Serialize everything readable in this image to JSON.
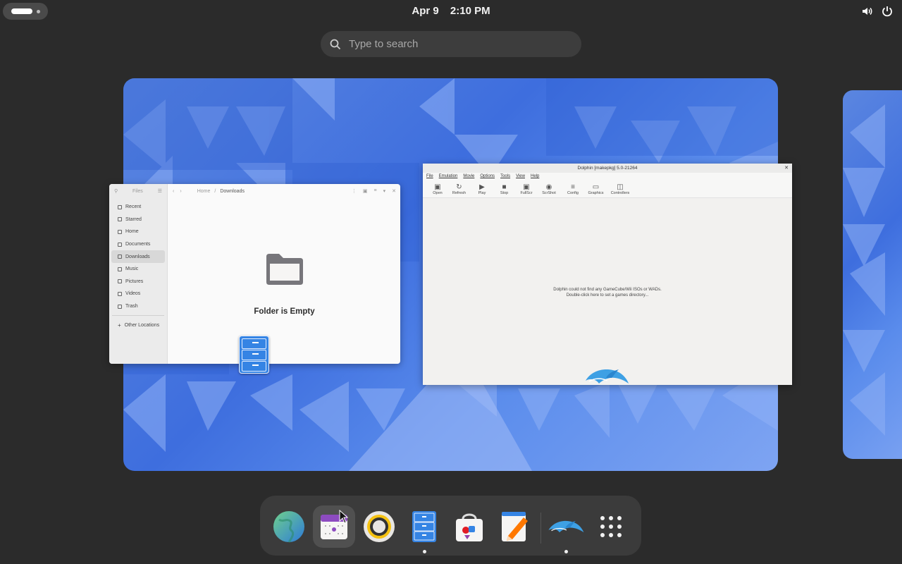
{
  "topbar": {
    "date": "Apr 9",
    "time": "2:10 PM",
    "tray": [
      "volume-icon",
      "power-icon"
    ]
  },
  "search": {
    "placeholder": "Type to search"
  },
  "files_window": {
    "sidebar_title": "Files",
    "sidebar_items": [
      {
        "label": "Recent",
        "icon": "clock-icon"
      },
      {
        "label": "Starred",
        "icon": "star-icon"
      },
      {
        "label": "Home",
        "icon": "home-icon"
      },
      {
        "label": "Documents",
        "icon": "document-icon"
      },
      {
        "label": "Downloads",
        "icon": "download-icon",
        "active": true
      },
      {
        "label": "Music",
        "icon": "music-icon"
      },
      {
        "label": "Pictures",
        "icon": "picture-icon"
      },
      {
        "label": "Videos",
        "icon": "video-icon"
      },
      {
        "label": "Trash",
        "icon": "trash-icon"
      }
    ],
    "other_locations": "Other Locations",
    "path": [
      "Home",
      "Downloads"
    ],
    "empty_message": "Folder is Empty"
  },
  "dolphin_window": {
    "title": "Dolphin [makepkg] 5.0-21264",
    "menu": [
      "File",
      "Emulation",
      "Movie",
      "Options",
      "Tools",
      "View",
      "Help"
    ],
    "toolbar": [
      "Open",
      "Refresh",
      "Play",
      "Stop",
      "FullScr",
      "ScrShot",
      "Config",
      "Graphics",
      "Controllers"
    ],
    "message_line1": "Dolphin could not find any GameCube/Wii ISOs or WADs.",
    "message_line2": "Double-click here to set a games directory..."
  },
  "dock": {
    "items": [
      {
        "name": "web-browser",
        "running": false
      },
      {
        "name": "calendar",
        "running": false,
        "hover": true
      },
      {
        "name": "rhythmbox",
        "running": false
      },
      {
        "name": "files",
        "running": true
      },
      {
        "name": "software-store",
        "running": false
      },
      {
        "name": "text-editor",
        "running": false
      },
      {
        "name": "dolphin-emulator",
        "running": true
      },
      {
        "name": "show-apps",
        "running": false
      }
    ]
  },
  "colors": {
    "accent": "#3584e4",
    "panel": "#2b2b2b",
    "dock": "#3b3b3b"
  }
}
